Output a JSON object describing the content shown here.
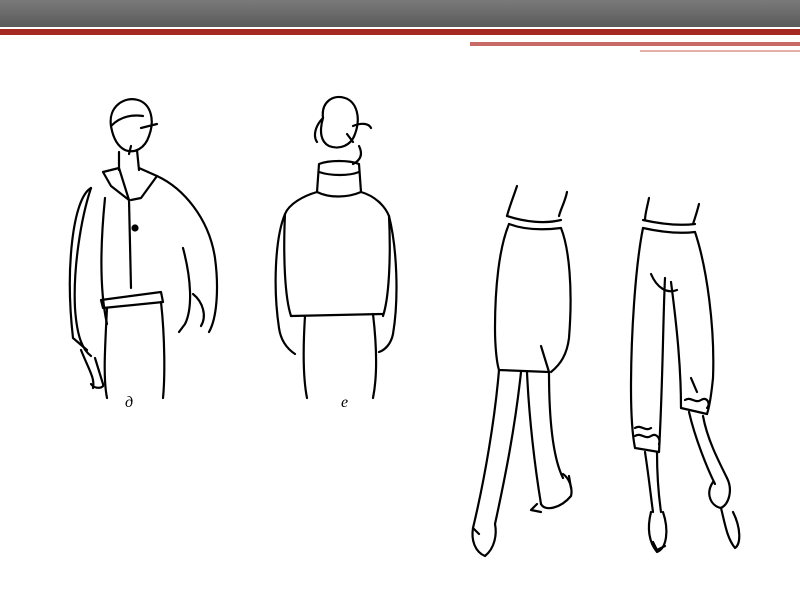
{
  "slide": {
    "figure_left": {
      "caption_d": "д",
      "caption_e": "е"
    }
  },
  "colors": {
    "top_bar": "#6a6a6a",
    "accent_red": "#a42a22"
  }
}
